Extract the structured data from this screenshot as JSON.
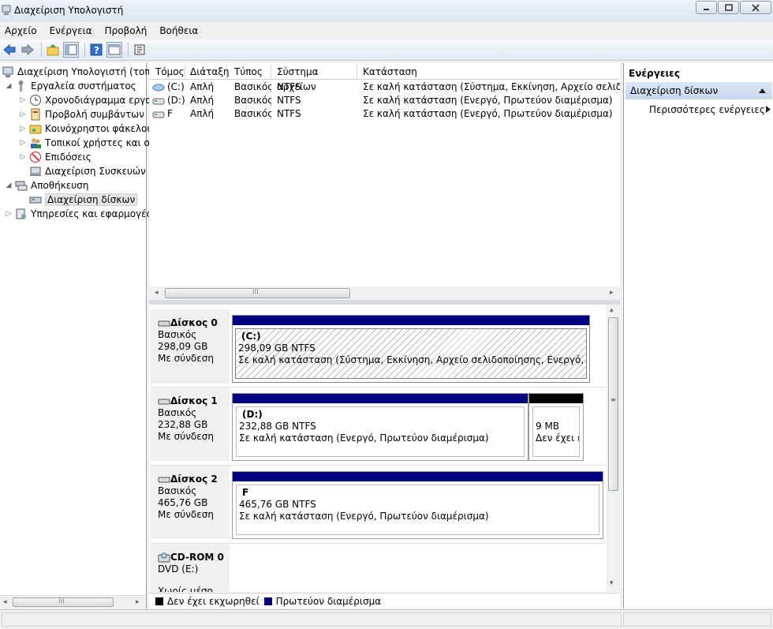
{
  "window": {
    "title": "Διαχείριση Υπολογιστή",
    "controls": {
      "minimize": "▭",
      "maximize": "□",
      "close": "✕"
    }
  },
  "menu": [
    "Αρχείο",
    "Ενέργεια",
    "Προβολή",
    "Βοήθεια"
  ],
  "toolbar": {
    "icons": [
      "back-arrow-icon",
      "forward-arrow-icon",
      "up-folder-icon",
      "show-hide-tree-icon",
      "help-icon",
      "properties-icon",
      "export-icon"
    ]
  },
  "tree": {
    "items": [
      {
        "label": "Διαχείριση Υπολογιστή (τοπικός)",
        "icon": "computer-management-icon",
        "level": 0,
        "expander": ""
      },
      {
        "label": "Εργαλεία συστήματος",
        "icon": "system-tools-icon",
        "level": 1,
        "expander": "◢"
      },
      {
        "label": "Χρονοδιάγραμμα εργασιών",
        "icon": "clock-icon",
        "level": 2,
        "expander": "▷"
      },
      {
        "label": "Προβολή συμβάντων",
        "icon": "event-viewer-icon",
        "level": 2,
        "expander": "▷"
      },
      {
        "label": "Κοινόχρηστοι φάκελοι",
        "icon": "shared-folder-icon",
        "level": 2,
        "expander": "▷"
      },
      {
        "label": "Τοπικοί χρήστες και ομάδες",
        "icon": "users-icon",
        "level": 2,
        "expander": "▷"
      },
      {
        "label": "Επιδόσεις",
        "icon": "performance-icon",
        "level": 2,
        "expander": "▷"
      },
      {
        "label": "Διαχείριση Συσκευών",
        "icon": "device-manager-icon",
        "level": 2,
        "expander": ""
      },
      {
        "label": "Αποθήκευση",
        "icon": "storage-icon",
        "level": 1,
        "expander": "◢"
      },
      {
        "label": "Διαχείριση δίσκων",
        "icon": "disk-management-icon",
        "level": 2,
        "expander": "",
        "selected": true
      },
      {
        "label": "Υπηρεσίες και εφαρμογές",
        "icon": "services-icon",
        "level": 1,
        "expander": "▷"
      }
    ]
  },
  "volumes": {
    "columns": [
      "Τόμος",
      "Διάταξη",
      "Τύπος",
      "Σύστημα αρχείων",
      "Κατάσταση"
    ],
    "rows": [
      {
        "volume": "(C:)",
        "layout": "Απλή",
        "type": "Βασικός",
        "fs": "NTFS",
        "status": "Σε καλή κατάσταση (Σύστημα, Εκκίνηση, Αρχείο σελιδοποίησης"
      },
      {
        "volume": "(D:)",
        "layout": "Απλή",
        "type": "Βασικός",
        "fs": "NTFS",
        "status": "Σε καλή κατάσταση (Ενεργό, Πρωτεύον διαμέρισμα)"
      },
      {
        "volume": "F",
        "layout": "Απλή",
        "type": "Βασικός",
        "fs": "NTFS",
        "status": "Σε καλή κατάσταση (Ενεργό, Πρωτεύον διαμέρισμα)"
      }
    ]
  },
  "disks": [
    {
      "name": "Δίσκος 0",
      "type": "Βασικός",
      "size": "298,09 GB",
      "state": "Με σύνδεση",
      "partitions": [
        {
          "label": "(C:)",
          "size": "298,09 GB NTFS",
          "status": "Σε καλή κατάσταση (Σύστημα, Εκκίνηση, Αρχείο σελιδοποίησης, Ενεργό, Αποτύπω",
          "kind": "primary",
          "selected": true
        }
      ]
    },
    {
      "name": "Δίσκος 1",
      "type": "Βασικός",
      "size": "232,88 GB",
      "state": "Με σύνδεση",
      "partitions": [
        {
          "label": "(D:)",
          "size": "232,88 GB NTFS",
          "status": "Σε καλή κατάσταση (Ενεργό, Πρωτεύον διαμέρισμα)",
          "kind": "primary"
        },
        {
          "label": "",
          "size": "9 MB",
          "status": "Δεν έχει εκ",
          "kind": "unallocated"
        }
      ]
    },
    {
      "name": "Δίσκος 2",
      "type": "Βασικός",
      "size": "465,76 GB",
      "state": "Με σύνδεση",
      "partitions": [
        {
          "label": "F",
          "size": "465,76 GB NTFS",
          "status": "Σε καλή κατάσταση (Ενεργό, Πρωτεύον διαμέρισμα)",
          "kind": "primary"
        }
      ]
    },
    {
      "name": "CD-ROM 0",
      "type": "DVD (E:)",
      "size": "",
      "state": "Χωρίς μέσο",
      "partitions": []
    }
  ],
  "legend": [
    {
      "label": "Δεν έχει εκχωρηθεί",
      "color": "#000000"
    },
    {
      "label": "Πρωτεύον διαμέρισμα",
      "color": "#000080"
    }
  ],
  "actions": {
    "title": "Ενέργειες",
    "group": "Διαχείριση δίσκων",
    "more": "Περισσότερες ενέργειες"
  },
  "scroll": {
    "grip": "⁞⁞⁞",
    "left": "◂",
    "right": "▸",
    "up": "▴",
    "down": "▾"
  },
  "colors": {
    "primary": "#000080",
    "unallocated": "#000000",
    "accent": "#c6d6ec"
  }
}
